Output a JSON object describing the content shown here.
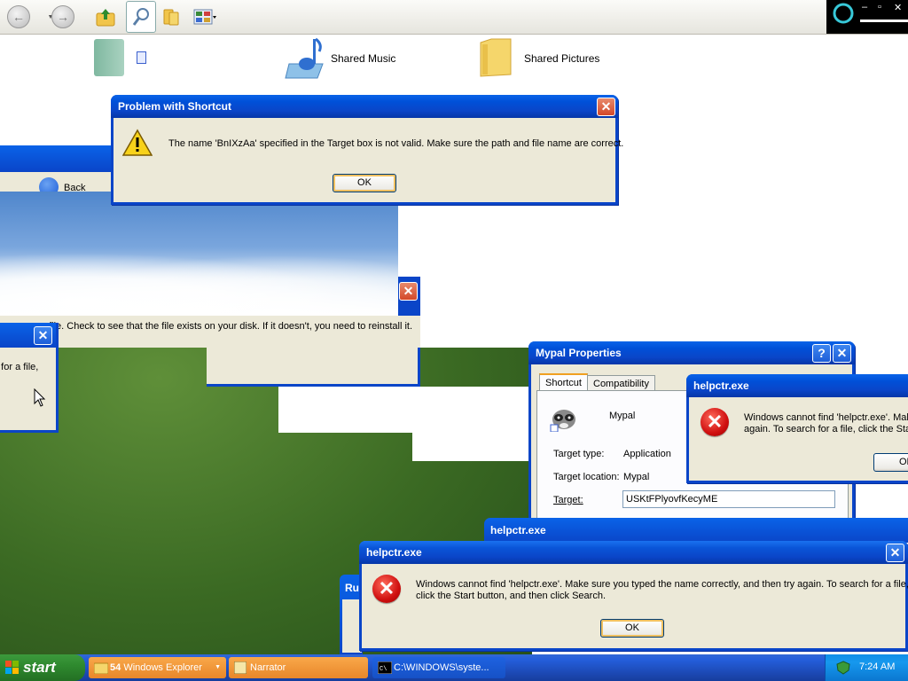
{
  "toolbar": {
    "back_icon": "back-arrow-icon",
    "forward_icon": "forward-arrow-icon",
    "up_icon": "up-folder-icon",
    "search_icon": "search-icon",
    "folders_icon": "folders-icon",
    "views_icon": "views-icon",
    "window_controls": {
      "minimize": "–",
      "restore": "▫",
      "close": "✕"
    }
  },
  "folders": [
    {
      "label": "",
      "icon": "folder-icon"
    },
    {
      "label": "Shared Music",
      "icon": "music-folder-icon"
    },
    {
      "label": "Shared Pictures",
      "icon": "pictures-folder-icon"
    }
  ],
  "background_explorer": {
    "back_label": "Back"
  },
  "partial_dialog_left": {
    "text": "h for a file,"
  },
  "partial_dialog_mid": {
    "text": "file. Check to see that the file exists on your disk. If it doesn't, you need to reinstall it."
  },
  "problem_dialog": {
    "title": "Problem with Shortcut",
    "message": "The name 'BnIXzAa' specified in the Target box is not valid. Make sure the path and file name are correct.",
    "ok": "OK"
  },
  "mypal_properties": {
    "title": "Mypal Properties",
    "help": "?",
    "tabs": [
      "Shortcut",
      "Compatibility"
    ],
    "app_name": "Mypal",
    "target_type_label": "Target type:",
    "target_type_value": "Application",
    "target_location_label": "Target location:",
    "target_location_value": "Mypal",
    "target_label": "Target:",
    "target_value": "USKtFPlyovfKecyME"
  },
  "helpctr_right": {
    "title": "helpctr.exe",
    "line1": "Windows cannot find 'helpctr.exe'. Mak",
    "line2": "again. To search for a file, click the Star",
    "ok": "OK"
  },
  "helpctr_back": {
    "title": "helpctr.exe"
  },
  "run_dialog": {
    "title": "Ru"
  },
  "helpctr_front": {
    "title": "helpctr.exe",
    "line1": "Windows cannot find 'helpctr.exe'. Make sure you typed the name correctly, and then try again. To search for a file,",
    "line2": "click the Start button, and then click Search.",
    "ok": "OK"
  },
  "taskbar": {
    "start": "start",
    "items": [
      {
        "count": "54",
        "label": "Windows Explorer"
      },
      {
        "label": "Narrator"
      },
      {
        "label": "C:\\WINDOWS\\syste..."
      }
    ],
    "clock": "7:24 AM"
  },
  "colors": {
    "xp_blue": "#0a45c8",
    "taskbar": "#245edb",
    "start_green": "#2f8a2f",
    "error_red": "#d01010"
  }
}
